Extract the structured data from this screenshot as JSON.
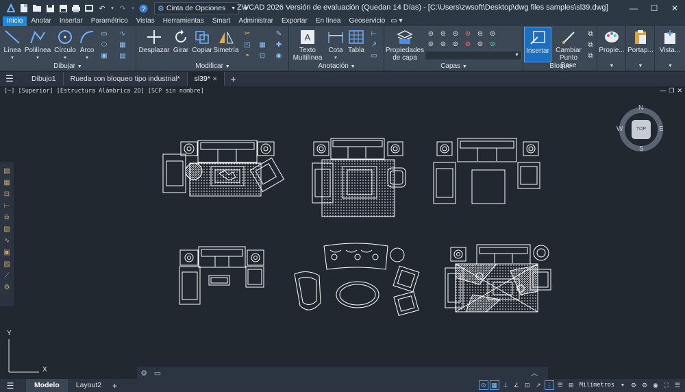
{
  "title": {
    "quick_access_icons": [
      "app-logo-icon",
      "new-file-icon",
      "open-file-icon",
      "save-icon",
      "save-as-icon",
      "print-icon",
      "print-preview-icon",
      "undo-icon",
      "redo-icon",
      "help-icon"
    ],
    "workspace": "Cinta de Opciones",
    "window_title": "ZWCAD 2026 Versión de evaluación (Quedan 14 Días) - [C:\\Users\\zwsoft\\Desktop\\dwg files samples\\sl39.dwg]",
    "controls": {
      "minimize": "—",
      "maximize": "☐",
      "close": "✕"
    }
  },
  "menu_tabs": [
    "Inicio",
    "Anotar",
    "Insertar",
    "Paramétrico",
    "Vistas",
    "Herramientas",
    "Smart",
    "Administrar",
    "Exportar",
    "En línea",
    "Geoservicio"
  ],
  "active_menu_tab": "Inicio",
  "ribbon": {
    "dibujar": {
      "title": "Dibujar",
      "tools": [
        "Línea",
        "Polilínea",
        "Círculo",
        "Arco"
      ]
    },
    "modificar": {
      "title": "Modificar",
      "tools": [
        "Desplazar",
        "Girar",
        "Copiar",
        "Simetría"
      ]
    },
    "anotacion": {
      "title": "Anotación",
      "tools": [
        "Texto\nMultilínea",
        "Cota",
        "Tabla"
      ]
    },
    "capas": {
      "title": "Capas",
      "tools": [
        "Propiedades\nde capa"
      ]
    },
    "bloque": {
      "title": "Bloque",
      "tools": [
        "Insertar",
        "Cambiar\nPunto Base"
      ]
    },
    "extra": [
      "Propie...",
      "Portap...",
      "Vista..."
    ]
  },
  "doc_tabs": [
    "Dibujo1",
    "Rueda con bloqueo tipo industrial*",
    "sl39*"
  ],
  "active_doc_tab": "sl39*",
  "viewport_label": "[—] [Superior] [Estructura Alámbrica 2D] [SCP sin nombre]",
  "viewcube": {
    "top": "TOP",
    "north": "N",
    "south": "S",
    "east": "E",
    "west": "W"
  },
  "ucs": {
    "x": "X",
    "y": "Y"
  },
  "layouts": [
    "Modelo",
    "Layout2"
  ],
  "active_layout": "Modelo",
  "units": "Milímetros",
  "colors": {
    "accent": "#1e88e5",
    "background": "#212830",
    "ribbon": "#3c4856",
    "line": "#ffffff"
  }
}
